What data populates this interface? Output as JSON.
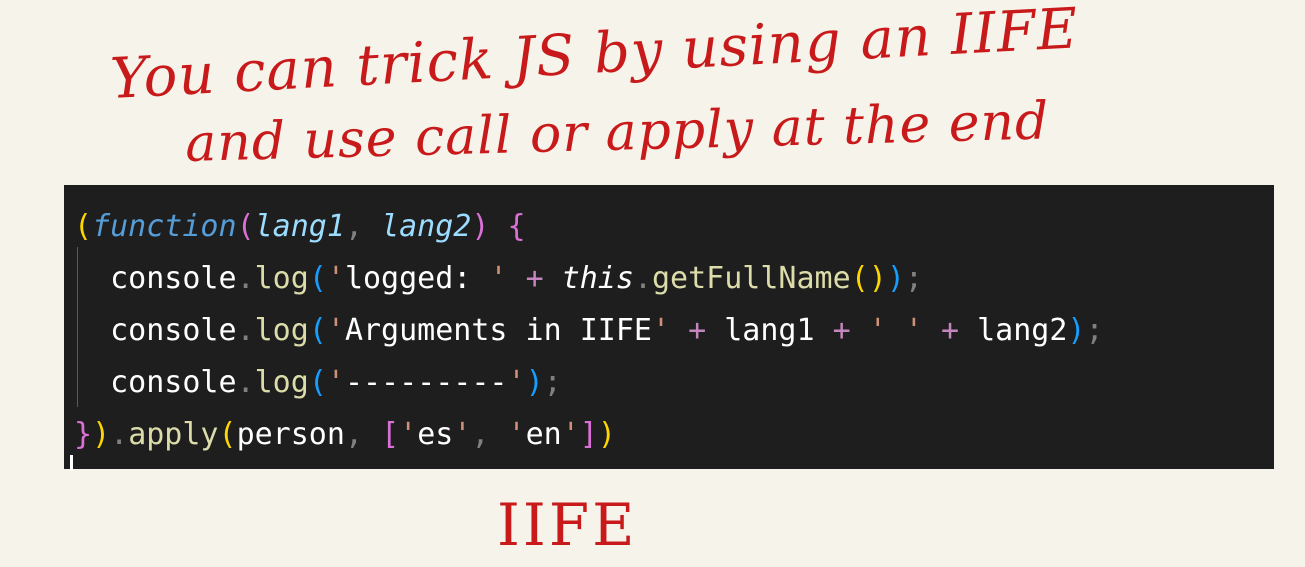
{
  "annotation": {
    "line1": "You can trick JS by using an IIFE",
    "line2": "and use call or apply at the end",
    "label": "IIFE",
    "color": "#c8191b"
  },
  "editor": {
    "background": "#1e1e1e",
    "lines": [
      "(function(lang1, lang2) {",
      "  console.log('logged: ' + this.getFullName());",
      "  console.log('Arguments in IIFE' + lang1 + ' ' + lang2);",
      "  console.log('---------');",
      "}).apply(person, ['es', 'en'])"
    ]
  }
}
